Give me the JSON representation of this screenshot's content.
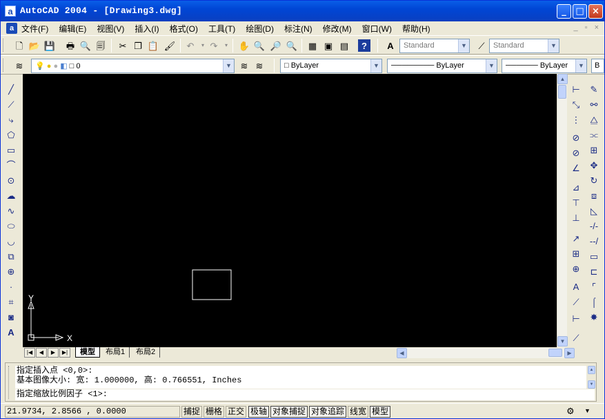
{
  "window": {
    "app_icon": "a",
    "title": "AutoCAD 2004 - [Drawing3.dwg]",
    "buttons": [
      "_",
      "□",
      "×"
    ]
  },
  "menubar": {
    "doc_icon": "a",
    "items": [
      "文件(F)",
      "编辑(E)",
      "视图(V)",
      "插入(I)",
      "格式(O)",
      "工具(T)",
      "绘图(D)",
      "标注(N)",
      "修改(M)",
      "窗口(W)",
      "帮助(H)"
    ],
    "doc_buttons": [
      "_",
      "▫",
      "×"
    ]
  },
  "standard_toolbar": {
    "icons": [
      "new-icon",
      "open-icon",
      "save-icon",
      "print-icon",
      "preview-icon",
      "publish-icon",
      "cut-icon",
      "copy-icon",
      "paste-icon",
      "matchprop-icon",
      "undo-icon",
      "redo-icon",
      "pan-icon",
      "zoom-realtime-icon",
      "zoom-window-icon",
      "zoom-previous-icon",
      "properties-icon",
      "designcenter-icon",
      "toolpalettes-icon",
      "help-icon"
    ],
    "text_style": "Standard",
    "dim_style": "Standard"
  },
  "layers_toolbar": {
    "layer_name": "0",
    "color": "ByLayer",
    "linetype": "ByLayer",
    "lineweight": "ByLayer",
    "plot_style": "B"
  },
  "layout_tabs": [
    "模型",
    "布局1",
    "布局2"
  ],
  "ucs": {
    "x_label": "X",
    "y_label": "Y"
  },
  "command": {
    "history": [
      "指定插入点 <0,0>:",
      "基本图像大小: 宽: 1.000000, 高: 0.766551, Inches"
    ],
    "prompt": "指定缩放比例因子 <1>:"
  },
  "status": {
    "coords": "21.9734, 2.8566 , 0.0000",
    "toggles": [
      {
        "label": "捕捉",
        "on": false
      },
      {
        "label": "栅格",
        "on": false
      },
      {
        "label": "正交",
        "on": false
      },
      {
        "label": "极轴",
        "on": true
      },
      {
        "label": "对象捕捉",
        "on": true
      },
      {
        "label": "对象追踪",
        "on": true
      },
      {
        "label": "线宽",
        "on": false
      },
      {
        "label": "模型",
        "on": true
      }
    ]
  },
  "colors": {
    "title_bar": "#0046d5",
    "canvas": "#000000",
    "chrome": "#ece9d8"
  }
}
